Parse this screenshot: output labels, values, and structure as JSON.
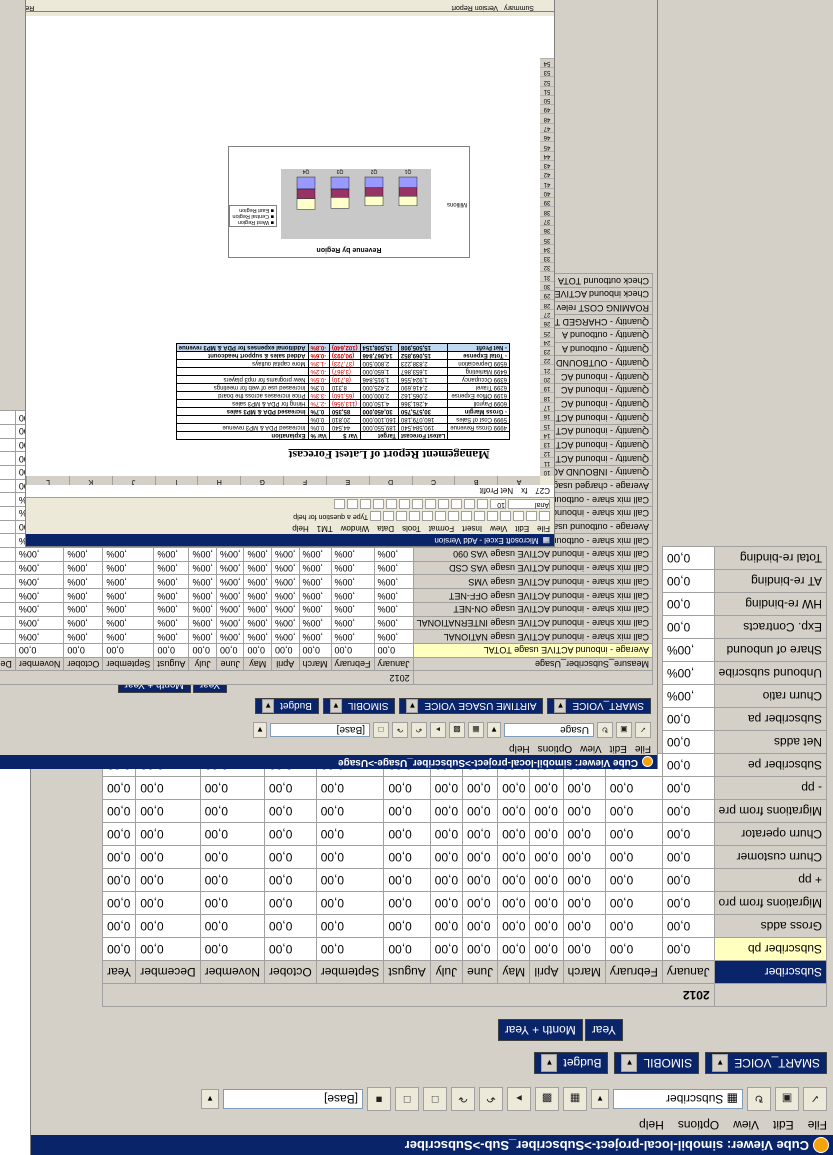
{
  "subscriber_window": {
    "title": "Cube Viewer: simobil-local-project->Subscriber_Sub->Subscriber",
    "menu": [
      "File",
      "Edit",
      "View",
      "Options",
      "Help"
    ],
    "view_combo": "Subscriber",
    "base_combo": "[Base]",
    "dims": [
      {
        "label": "SMART_VOICE"
      },
      {
        "label": "SIMOBIL"
      },
      {
        "label": "Budget"
      }
    ],
    "col_dims": [
      "Year",
      "Month + Year"
    ],
    "row_dim": "Subscriber",
    "year": "2012",
    "months": [
      "January",
      "February",
      "March",
      "April",
      "May",
      "June",
      "July",
      "August",
      "September",
      "October",
      "November",
      "December",
      "Year"
    ],
    "rows": [
      {
        "label": "Subscriber pb",
        "values": [
          "0,00",
          "0,00",
          "0,00",
          "0,00",
          "0,00",
          "0,00",
          "0,00",
          "0,00",
          "0,00",
          "0,00",
          "0,00",
          "0,00",
          "0,00"
        ]
      },
      {
        "label": "Gross adds",
        "values": [
          "0,00",
          "0,00",
          "0,00",
          "0,00",
          "0,00",
          "0,00",
          "0,00",
          "0,00",
          "0,00",
          "0,00",
          "0,00",
          "0,00",
          "0,00"
        ]
      },
      {
        "label": "Migrations from pro",
        "values": [
          "0,00",
          "0,00",
          "0,00",
          "0,00",
          "0,00",
          "0,00",
          "0,00",
          "0,00",
          "0,00",
          "0,00",
          "0,00",
          "0,00",
          "0,00"
        ]
      },
      {
        "label": "+ pp",
        "values": [
          "0,00",
          "0,00",
          "0,00",
          "0,00",
          "0,00",
          "0,00",
          "0,00",
          "0,00",
          "0,00",
          "0,00",
          "0,00",
          "0,00",
          "0,00"
        ]
      },
      {
        "label": "Churn customer",
        "values": [
          "0,00",
          "0,00",
          "0,00",
          "0,00",
          "0,00",
          "0,00",
          "0,00",
          "0,00",
          "0,00",
          "0,00",
          "0,00",
          "0,00",
          "0,00"
        ]
      },
      {
        "label": "Churn operator",
        "values": [
          "0,00",
          "0,00",
          "0,00",
          "0,00",
          "0,00",
          "0,00",
          "0,00",
          "0,00",
          "0,00",
          "0,00",
          "0,00",
          "0,00",
          "0,00"
        ]
      },
      {
        "label": "Migrations from pre",
        "values": [
          "0,00",
          "0,00",
          "0,00",
          "0,00",
          "0,00",
          "0,00",
          "0,00",
          "0,00",
          "0,00",
          "0,00",
          "0,00",
          "0,00",
          "0,00"
        ]
      },
      {
        "label": "- pp",
        "values": [
          "0,00",
          "0,00",
          "0,00",
          "0,00",
          "0,00",
          "0,00",
          "0,00",
          "0,00",
          "0,00",
          "0,00",
          "0,00",
          "0,00",
          "0,00"
        ]
      },
      {
        "label": "Subscriber pe",
        "values": [
          "0,00",
          "0,00",
          "0,00",
          "0,00",
          "0,00",
          "0,00",
          "0,00",
          "0,00",
          "0,00",
          "0,00",
          "0,00",
          "0,00",
          "0,00"
        ]
      },
      {
        "label": "Net adds",
        "values": [
          "0,00"
        ]
      },
      {
        "label": "Subscriber pa",
        "values": [
          "0,00"
        ]
      },
      {
        "label": "Churn ratio",
        "values": [
          ",00%"
        ]
      },
      {
        "label": "Unbound subscribe",
        "values": [
          ",00%"
        ]
      },
      {
        "label": "Share of unbound",
        "values": [
          ",00%"
        ]
      },
      {
        "label": "Exp. Contracts",
        "values": [
          "0,00"
        ]
      },
      {
        "label": "HW re-binding",
        "values": [
          "0,00"
        ]
      },
      {
        "label": "AT re-binding",
        "values": [
          "0,00"
        ]
      },
      {
        "label": "Total re-binding",
        "values": [
          "0,00"
        ]
      }
    ]
  },
  "usage_window": {
    "title": "Cube Viewer: simobil-local-project->Subscriber_Usage->Usage",
    "menu": [
      "File",
      "Edit",
      "View",
      "Options",
      "Help"
    ],
    "view_combo": "Usage",
    "base_combo": "[Base]",
    "dims": [
      {
        "label": "SMART_VOICE"
      },
      {
        "label": "AIRTIME USAGE VOICE"
      },
      {
        "label": "SIMOBIL"
      },
      {
        "label": "Budget"
      }
    ],
    "col_dims": [
      "Year",
      "Month + Year"
    ],
    "row_dim": "Measure_Subscriber_Usage",
    "year": "2012",
    "months": [
      "January",
      "February",
      "March",
      "April",
      "May",
      "June",
      "July",
      "August",
      "September",
      "October",
      "November",
      "December",
      "Year"
    ],
    "rows": [
      {
        "label": "Average - inbound ACTIVE usage TOTAL",
        "v": "0,00",
        "hl": true
      },
      {
        "label": "Call mix share - inbound ACTIVE usage NATIONAL",
        "v": ",00%"
      },
      {
        "label": "Call mix share - inbound ACTIVE usage INTERNATIONAL",
        "v": ",00%"
      },
      {
        "label": "Call mix share - inbound ACTIVE usage ON-NET",
        "v": ",00%"
      },
      {
        "label": "Call mix share - inbound ACTIVE usage OFF-NET",
        "v": ",00%"
      },
      {
        "label": "Call mix share - inbound ACTIVE usage VMS",
        "v": ",00%"
      },
      {
        "label": "Call mix share - inbound ACTIVE usage VAS CSD",
        "v": ",00%"
      },
      {
        "label": "Call mix share - inbound ACTIVE usage VAS 090",
        "v": ",00%"
      },
      {
        "label": "Call mix share - outbound ACTIVE usage TOTAL",
        "v": ",00%"
      },
      {
        "label": "Average - outbound usage TOTAL",
        "v": "0,00"
      },
      {
        "label": "Call mix share - inbound ACTIVE usage TOTAL",
        "v": ",00%"
      },
      {
        "label": "Call mix share - outbound PASSIVE usage TOTAL",
        "v": ",00%"
      },
      {
        "label": "Average - charged usage TOTAL",
        "v": "0,00"
      },
      {
        "label": "Quantity - INBOUND ACTIVE usage TOTAL",
        "v": "0,00"
      },
      {
        "label": "Quantity - inbound ACTIVE usage NATIONAL",
        "v": "0,00"
      },
      {
        "label": "Quantity - inbound ACTIVE usage INTERNATIONAL",
        "v": "0,00"
      },
      {
        "label": "Quantity - inbound ACTIVE usage ON-NET",
        "v": "0,00"
      },
      {
        "label": "Quantity - inbound ACTIVE usage OFF-NET",
        "v": "0,00"
      },
      {
        "label": "Quantity - inbound AC",
        "v": "0,00"
      },
      {
        "label": "Quantity - inbound AC",
        "v": "0,00"
      },
      {
        "label": "Quantity - inbound AC",
        "v": "0,00"
      },
      {
        "label": "Quantity - OUTBOUND",
        "v": "0,00"
      },
      {
        "label": "Quantity - outbound A",
        "v": "0,00"
      },
      {
        "label": "Quantity - outbound A",
        "v": "0,00"
      },
      {
        "label": "Quantity - CHARGED T",
        "v": "0,00"
      },
      {
        "label": "ROAMING COST relev",
        "v": "0,00"
      },
      {
        "label": "Check inbound ACTIVE",
        "v": ",00%"
      },
      {
        "label": "Check outbound TOTA",
        "v": ",00%"
      }
    ]
  },
  "excel_window": {
    "title": "Microsoft Excel - Add Version",
    "menu": [
      "File",
      "Edit",
      "View",
      "Insert",
      "Format",
      "Tools",
      "Data",
      "Window",
      "TM1",
      "Help"
    ],
    "question_hint": "Type a question for help",
    "cell_ref": "C27",
    "formula": "Net Profit",
    "font": "Arial",
    "font_size": "10",
    "columns": [
      "A",
      "B",
      "C",
      "D",
      "E",
      "F",
      "G",
      "H",
      "I",
      "J",
      "K",
      "L"
    ],
    "row_numbers": [
      "10",
      "11",
      "12",
      "13",
      "14",
      "15",
      "16",
      "17",
      "18",
      "19",
      "20",
      "21",
      "22",
      "23",
      "24",
      "25",
      "26",
      "27",
      "28",
      "29",
      "30",
      "31",
      "32",
      "33",
      "34",
      "35",
      "36",
      "37",
      "38",
      "39",
      "40",
      "41",
      "42",
      "43",
      "44",
      "45",
      "46",
      "47",
      "48",
      "49",
      "50",
      "51",
      "52",
      "53",
      "54"
    ],
    "report_title": "Management Report of Latest Forecast",
    "report_headers": [
      "",
      "Latest Forecast",
      "Target",
      "Var $",
      "Var %",
      "Explanation"
    ],
    "report_rows": [
      {
        "cells": [
          "4999 Gross Revenue",
          "190,584,540",
          "189,550,000",
          "44,540",
          "0.0%",
          "Increased PDA & MP3 revenue"
        ],
        "red": false,
        "cls": ""
      },
      {
        "cells": [
          "5999 Cost of Sales",
          "160,079,180",
          "160,100,000",
          "20,810",
          "0.0%",
          ""
        ],
        "red": false,
        "cls": ""
      },
      {
        "cells": [
          "- Gross Margin",
          "30,575,750",
          "30,450,000",
          "85,350",
          "0.7%",
          "Increased PDA & MP3 sales"
        ],
        "red": false,
        "cls": "bold"
      },
      {
        "cells": [
          "6099 Payroll",
          "4,261,366",
          "4,150,000",
          "(113,956)",
          "-2.7%",
          "Hiring for PDA & MP3 sales"
        ],
        "red": true,
        "cls": ""
      },
      {
        "cells": [
          "6199 Office Expense",
          "2,065,162",
          "2,000,000",
          "(65,160)",
          "-3.3%",
          "Price increases across the board"
        ],
        "red": true,
        "cls": ""
      },
      {
        "cells": [
          "6299 Travel",
          "2,416,690",
          "2,425,000",
          "8,310",
          "0.3%",
          "Increased use of web for meetings"
        ],
        "red": false,
        "cls": ""
      },
      {
        "cells": [
          "6399 Occupancy",
          "1,924,556",
          "1,915,846",
          "(8,710)",
          "-0.5%",
          "New programs for mp3 players"
        ],
        "red": true,
        "cls": ""
      },
      {
        "cells": [
          "6499 Marketing",
          "1,653,867",
          "1,650,000",
          "(3,867)",
          "-0.2%",
          ""
        ],
        "red": true,
        "cls": ""
      },
      {
        "cells": [
          "6599 Depreciation",
          "2,838,223",
          "2,800,500",
          "(37,723)",
          "-1.3%",
          "More capital outlays"
        ],
        "red": true,
        "cls": ""
      },
      {
        "cells": [
          "- Total Expense",
          "15,069,852",
          "14,967,846",
          "(90,093)",
          "-0.6%",
          "Added sales & support headcount"
        ],
        "red": true,
        "cls": "bold"
      },
      {
        "cells": [
          "- Net Profit",
          "15,505,908",
          "15,508,154",
          "(102,640)",
          "-0.8%",
          "Additional expenses for PDA & MP3 revenue"
        ],
        "red": true,
        "cls": "blue"
      }
    ],
    "chart": {
      "title": "Revenue by Region",
      "ylabel": "Millions",
      "yticks": [
        "0",
        "20",
        "40",
        "60",
        "80"
      ],
      "categories": [
        "Q1",
        "Q2",
        "Q3",
        "Q4"
      ],
      "legend": [
        "West Region",
        "Central Region",
        "East Region"
      ]
    },
    "sheet_tabs": [
      "Summary",
      "Version Report"
    ],
    "status": "Ready"
  },
  "colors": {
    "title_bar": "#0a246a",
    "window_face": "#d4d0c8",
    "highlight_row": "#ffffc0"
  }
}
